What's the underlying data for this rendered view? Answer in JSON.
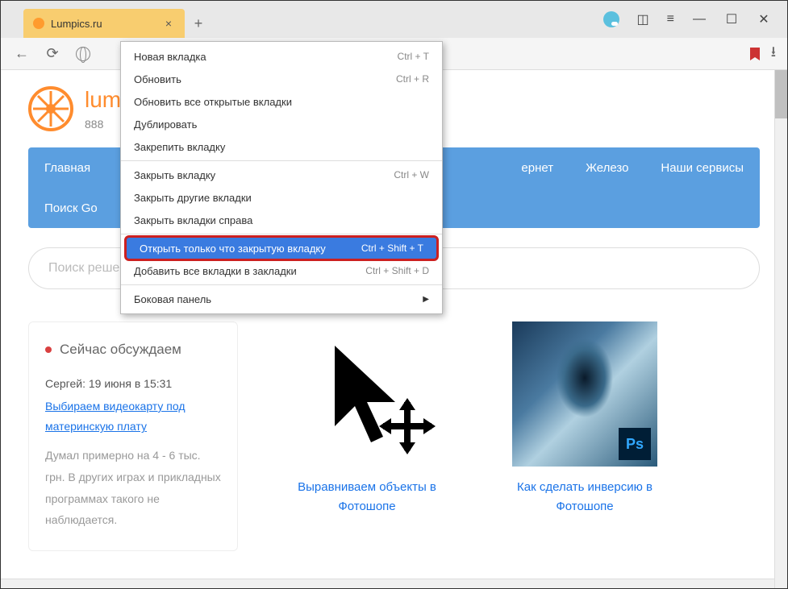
{
  "tab": {
    "title": "Lumpics.ru"
  },
  "site": {
    "name": "lumpics.ru",
    "phone": "888"
  },
  "nav": {
    "row1": [
      "Главная",
      "",
      "",
      "",
      "ернет",
      "Железо",
      "Наши сервисы"
    ],
    "row2": [
      "Поиск Go"
    ]
  },
  "search": {
    "placeholder": "Поиск решения..."
  },
  "discussion": {
    "heading": "Сейчас обсуждаем",
    "meta": "Сергей: 19 июня в 15:31",
    "link": "Выбираем видеокарту под материнскую плату",
    "text": "Думал примерно на 4 - 6 тыс. грн. В других играх и прикладных программах такого не наблюдается."
  },
  "articles": [
    {
      "title": "Выравниваем объекты в Фотошопе"
    },
    {
      "title": "Как сделать инверсию в Фотошопе",
      "ps_label": "Ps"
    }
  ],
  "context_menu": [
    {
      "label": "Новая вкладка",
      "shortcut": "Ctrl + T"
    },
    {
      "label": "Обновить",
      "shortcut": "Ctrl + R"
    },
    {
      "label": "Обновить все открытые вкладки"
    },
    {
      "label": "Дублировать"
    },
    {
      "label": "Закрепить вкладку"
    },
    {
      "divider": true
    },
    {
      "label": "Закрыть вкладку",
      "shortcut": "Ctrl + W"
    },
    {
      "label": "Закрыть другие вкладки"
    },
    {
      "label": "Закрыть вкладки справа"
    },
    {
      "divider": true
    },
    {
      "label": "Открыть только что закрытую вкладку",
      "shortcut": "Ctrl + Shift + T",
      "highlighted": true
    },
    {
      "label": "Добавить все вкладки в закладки",
      "shortcut": "Ctrl + Shift + D"
    },
    {
      "divider": true
    },
    {
      "label": "Боковая панель",
      "submenu": true
    }
  ]
}
